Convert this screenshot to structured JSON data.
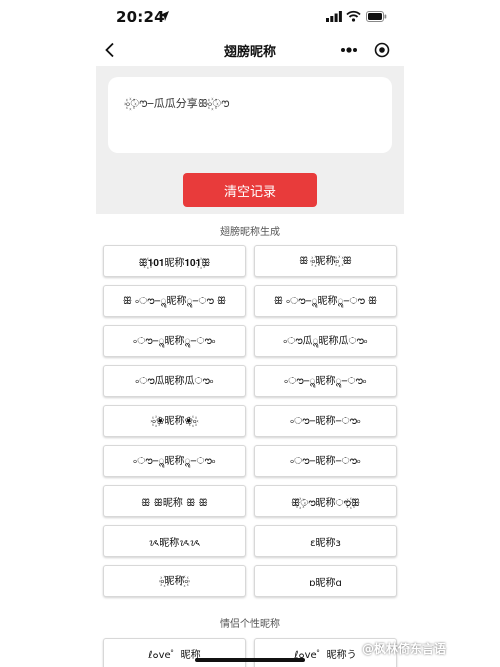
{
  "status_bar": {
    "time": "20:24",
    "icons": [
      "location-arrow-icon",
      "signal-icon",
      "wifi-icon",
      "battery-icon"
    ]
  },
  "nav": {
    "title": "翅膀昵称",
    "icons": [
      "back-icon",
      "more-icon",
      "target-icon"
    ]
  },
  "input": {
    "value": "৹꙰ൗ౼瓜瓜分享ꕥ৹꙰ൗ"
  },
  "clear_button": {
    "label": "清空记录",
    "color": "#e83b3b"
  },
  "section1": {
    "title": "翅膀昵称生成",
    "items": [
      "ꕥ꙰𝟏𝟎𝟏昵称𝟏𝟎𝟏꙰ꕥ",
      "ꕥ ৹꙰昵称৹꙰ ꕥ",
      "ꕥ ৹ൗ౼ॣ昵称ॣ౼ൗ ꕥ",
      "ꕥ ৹ൗ౼ॣ昵称ॣ౼ൗ ꕥ",
      "৹ൗ౼ॣ昵称ॣ౼ൗ৹",
      "৹ൗ瓜ॣ昵称瓜ൗ৹",
      "৹ൗ瓜昵称瓜ൗ৹",
      "৹ൗ౼ॣ昵称ॣ౼ൗ৹",
      "৹꙰❀昵称❀꙰৹",
      "৹ൗ౼昵称౼ൗ৹",
      "৹ൗ౼ॣ昵称ॣ౼ൗ৹",
      "৹ൗ౼昵称౼ൗ৹",
      "ꕥ ꕥ昵称 ꕥ ꕥ",
      "ꕥ꙰ൗ昵称ൗ꙰ꕥ",
      "ᝰ昵称ᝰᝰ",
      "ɛ昵称ɜ",
      "৹꙰昵称꙰৹",
      "ɒ昵称ɑ"
    ]
  },
  "section2": {
    "title": "情侣个性昵称",
    "items": [
      "ℓ๐ve゜昵称",
      "ℓ๐ve゜昵称う"
    ]
  },
  "watermark": "@枫林倚东言语"
}
